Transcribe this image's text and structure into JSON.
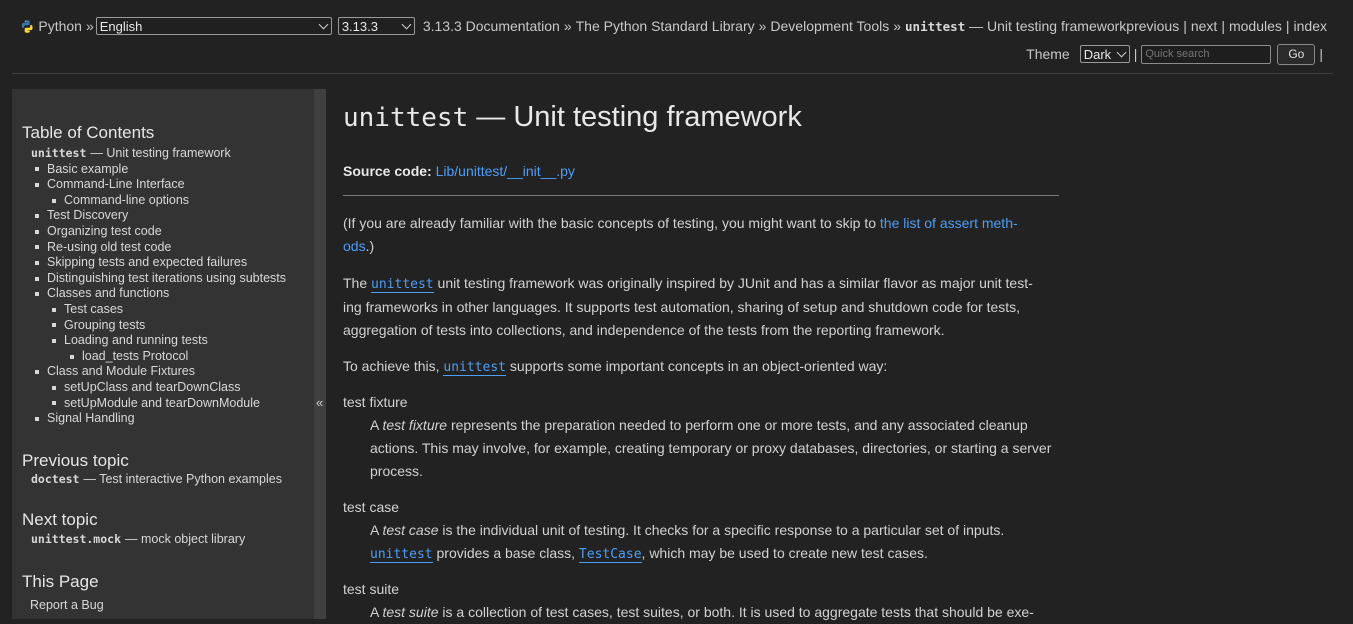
{
  "topbar": {
    "python_label": "Python",
    "breadcrumb_sep": "»",
    "language": "English",
    "version": "3.13.3",
    "crumbs": [
      "3.13.3 Documentation",
      "The Python Standard Library",
      "Development Tools"
    ],
    "current_mono": "unittest",
    "current_rest": "— Unit testing framework",
    "relnav": [
      "previous",
      "next",
      "modules",
      "index"
    ],
    "theme_label": "Theme",
    "theme_value": "Dark",
    "search_placeholder": "Quick search",
    "go_label": "Go"
  },
  "sidebar": {
    "toc_title": "Table of Contents",
    "toc": [
      {
        "level": 0,
        "mono": "unittest",
        "text": "— Unit testing framework"
      },
      {
        "level": 1,
        "text": "Basic example"
      },
      {
        "level": 1,
        "text": "Command-Line Interface"
      },
      {
        "level": 2,
        "text": "Command-line options"
      },
      {
        "level": 1,
        "text": "Test Discovery"
      },
      {
        "level": 1,
        "text": "Organizing test code"
      },
      {
        "level": 1,
        "text": "Re-using old test code"
      },
      {
        "level": 1,
        "text": "Skipping tests and expected failures"
      },
      {
        "level": 1,
        "text": "Distinguishing test iterations using subtests"
      },
      {
        "level": 1,
        "text": "Classes and functions"
      },
      {
        "level": 2,
        "text": "Test cases"
      },
      {
        "level": 2,
        "text": "Grouping tests"
      },
      {
        "level": 2,
        "text": "Loading and running tests"
      },
      {
        "level": 3,
        "text": "load_tests Protocol"
      },
      {
        "level": 1,
        "text": "Class and Module Fixtures"
      },
      {
        "level": 2,
        "text": "setUpClass and tearDownClass"
      },
      {
        "level": 2,
        "text": "setUpModule and tearDownModule"
      },
      {
        "level": 1,
        "text": "Signal Handling"
      }
    ],
    "prev_title": "Previous topic",
    "prev_mono": "doctest",
    "prev_text": "— Test interactive Python examples",
    "next_title": "Next topic",
    "next_mono": "unittest.mock",
    "next_text": "— mock object library",
    "this_page_title": "This Page",
    "report_bug": "Report a Bug",
    "collapse_glyph": "«"
  },
  "main": {
    "title_mono": "unittest",
    "title_rest": "— Unit testing framework",
    "source_label": "Source code:",
    "source_link": "Lib/unittest/__init__.py",
    "intro_a": "(If you are already familiar with the basic concepts of testing, you might want to skip to ",
    "intro_link_1": "the list of assert meth-",
    "intro_link_2": "ods",
    "intro_b": ".)",
    "p1_a": "The ",
    "p1_code": "unittest",
    "p1_b": " unit testing framework was originally inspired by JUnit and has a similar flavor as major unit test-",
    "p1_c": "ing frameworks in other languages. It supports test automation, sharing of setup and shutdown code for tests,",
    "p1_d": "aggregation of tests into collections, and independence of the tests from the reporting framework.",
    "p2_a": "To achieve this, ",
    "p2_code": "unittest",
    "p2_b": " supports some important concepts in an object-oriented way:",
    "dt1": "test fixture",
    "dd1_a": "A ",
    "dd1_em": "test fixture",
    "dd1_b": " represents the preparation needed to perform one or more tests, and any associated cleanup",
    "dd1_c": "actions. This may involve, for example, creating temporary or proxy databases, directories, or starting a server",
    "dd1_d": "process.",
    "dt2": "test case",
    "dd2_a": "A ",
    "dd2_em": "test case",
    "dd2_b": " is the individual unit of testing. It checks for a specific response to a particular set of inputs.",
    "dd2_code1": "unittest",
    "dd2_c": " provides a base class, ",
    "dd2_code2": "TestCase",
    "dd2_d": ", which may be used to create new test cases.",
    "dt3": "test suite",
    "dd3_a": "A ",
    "dd3_em": "test suite",
    "dd3_b": " is a collection of test cases, test suites, or both. It is used to aggregate tests that should be exe-"
  }
}
